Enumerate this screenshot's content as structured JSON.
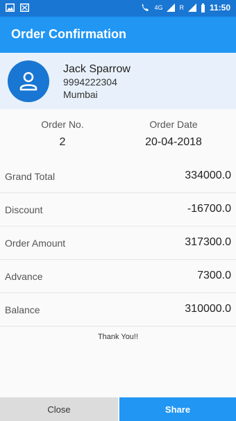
{
  "status_bar": {
    "network": "4G",
    "signal_label": "R",
    "time": "11:50"
  },
  "app_bar": {
    "title": "Order Confirmation"
  },
  "customer": {
    "name": "Jack Sparrow",
    "phone": "9994222304",
    "city": "Mumbai"
  },
  "order": {
    "no_label": "Order No.",
    "no_value": "2",
    "date_label": "Order Date",
    "date_value": "20-04-2018"
  },
  "summary": [
    {
      "label": "Grand Total",
      "value": "334000.0"
    },
    {
      "label": "Discount",
      "value": "-16700.0"
    },
    {
      "label": "Order Amount",
      "value": "317300.0"
    },
    {
      "label": "Advance",
      "value": "7300.0"
    },
    {
      "label": "Balance",
      "value": "310000.0"
    }
  ],
  "footer_note": "Thank You!!",
  "buttons": {
    "close": "Close",
    "share": "Share"
  },
  "colors": {
    "primary": "#2196f3",
    "primary_dark": "#1976d2",
    "header_bg": "#e8f1fb"
  },
  "icons": [
    "image-icon",
    "photo-icon",
    "call-forward-icon",
    "signal-icon",
    "battery-icon",
    "person-icon"
  ]
}
